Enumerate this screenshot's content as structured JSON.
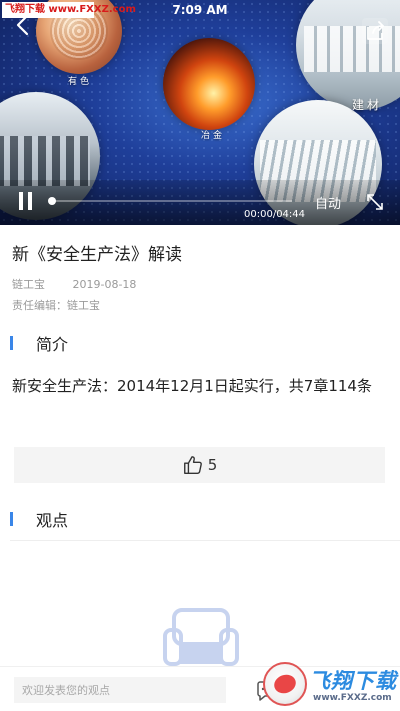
{
  "watermark_top": "飞翔下载 www.FXXZ.com",
  "status": {
    "time": "7:09 AM"
  },
  "video": {
    "categories": {
      "nonferrous": "有色",
      "metallurgy": "冶金",
      "building": "建材"
    },
    "player": {
      "state": "playing",
      "progress_fraction": 0.0,
      "time_readout": "00:00/04:44",
      "auto_label": "自动"
    }
  },
  "article": {
    "title": "新《安全生产法》解读",
    "source": "链工宝",
    "date": "2019-08-18",
    "editor": "责任编辑：链工宝"
  },
  "intro": {
    "heading": "简介",
    "text": "新安全生产法：2014年12月1日起实行，共7章114条"
  },
  "likes": {
    "count": "5"
  },
  "views": {
    "heading": "观点"
  },
  "comment": {
    "placeholder": "欢迎发表您的观点"
  },
  "watermark_bottom": {
    "title": "飞翔下载",
    "url": "www.FXXZ.com"
  },
  "colors": {
    "accent": "#3a86e8",
    "sofa": "#c7d3ef",
    "watermark_red": "#d81b1b",
    "watermark_blue": "#2c8be0"
  }
}
